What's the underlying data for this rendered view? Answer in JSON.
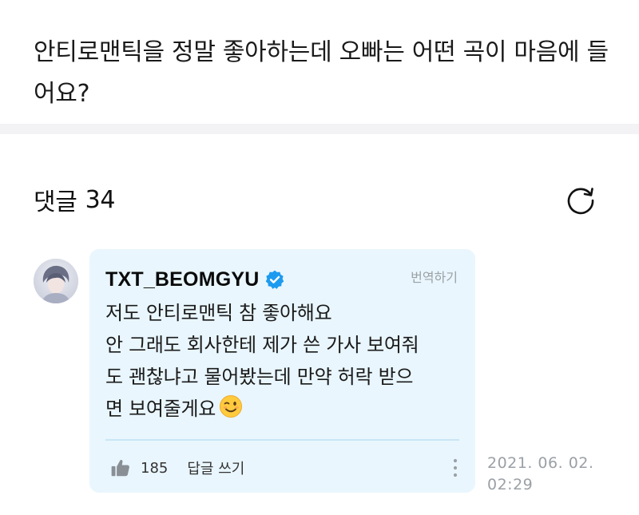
{
  "question": {
    "text": "안티로맨틱을 정말 좋아하는데 오빠는 어떤 곡이 마음에 들어요?"
  },
  "comments": {
    "label": "댓글",
    "count": "34"
  },
  "comment": {
    "author": "TXT_BEOMGYU",
    "verified": true,
    "translate_label": "번역하기",
    "body_lines": [
      "저도 안티로맨틱 참 좋아해요",
      "안 그래도 회사한테 제가 쓴 가사 보여줘",
      "도 괜찮냐고 물어봤는데 만약 허락 받으",
      "면 보여줄게요"
    ],
    "emoji": "winking-face-icon",
    "like_count": "185",
    "reply_label": "답글 쓰기",
    "date": "2021. 06. 02.",
    "time": "02:29"
  },
  "colors": {
    "bubble_bg": "#e9f6fd",
    "verified_badge": "#1d9bf0",
    "muted_text": "#9aa0a6",
    "divider_band": "#f3f3f6"
  }
}
